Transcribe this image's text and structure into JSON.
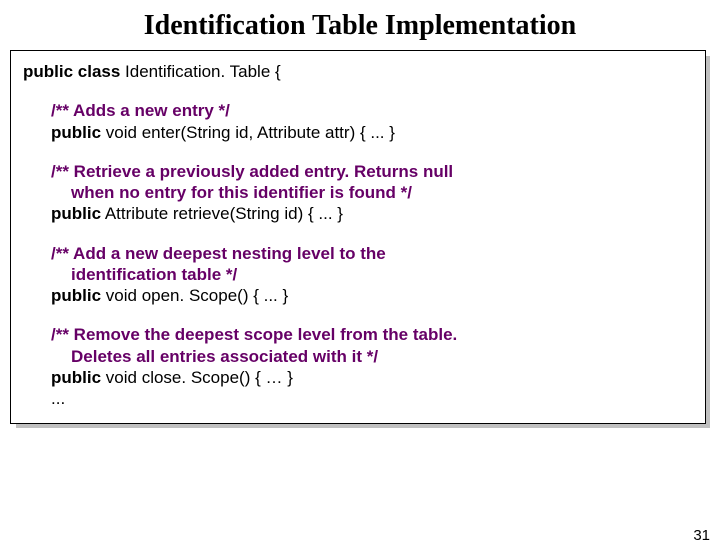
{
  "title": "Identification Table Implementation",
  "code": {
    "classDecl_pre": "public class",
    "classDecl_name": " Identification. Table {",
    "c1": "/** Adds a new entry */",
    "m1_pre": "public",
    "m1_rest": " void enter(String id, Attribute attr) { ... }",
    "c2a": "/** Retrieve a previously added entry. Returns ",
    "c2a_null": "null",
    "c2b": "when no entry for this identifier is found */",
    "m2_pre": "public",
    "m2_rest": " Attribute retrieve(String id) { ... }",
    "c3a": "/** Add a new deepest nesting level to the",
    "c3b": "identification table */",
    "m3_pre": "public",
    "m3_rest": " void open. Scope() { ... }",
    "c4a": "/** Remove the deepest scope level from the table.",
    "c4b": "Deletes all entries associated with it */",
    "m4_pre": "public",
    "m4_rest": " void close. Scope() { … }",
    "dots": "..."
  },
  "pageNumber": "31"
}
